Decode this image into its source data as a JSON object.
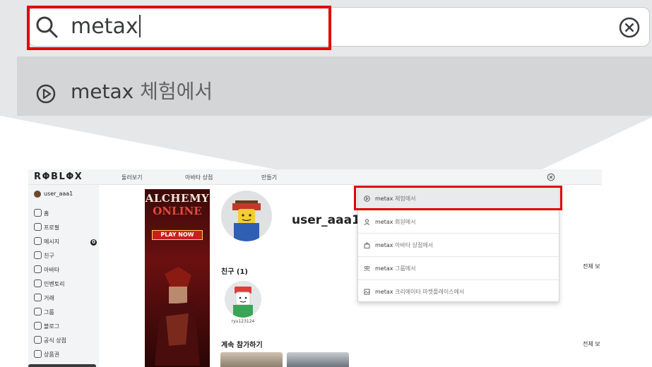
{
  "search": {
    "query": "metax",
    "suggestion": {
      "query": "metax",
      "suffix": "체험에서"
    }
  },
  "mini": {
    "logo": "RΦBLΦX",
    "nav": [
      "둘러보기",
      "아바타 상점",
      "만들기"
    ],
    "sidebar": {
      "user": "user_aaa1",
      "items": [
        {
          "label": "홈",
          "icon": "home-icon"
        },
        {
          "label": "프로필",
          "icon": "profile-icon"
        },
        {
          "label": "메시지",
          "icon": "message-icon",
          "badge": "0"
        },
        {
          "label": "친구",
          "icon": "friends-icon"
        },
        {
          "label": "아바타",
          "icon": "avatar-icon"
        },
        {
          "label": "인벤토리",
          "icon": "inventory-icon"
        },
        {
          "label": "거래",
          "icon": "trade-icon"
        },
        {
          "label": "그룹",
          "icon": "groups-icon"
        },
        {
          "label": "블로그",
          "icon": "blog-icon"
        },
        {
          "label": "공식 상점",
          "icon": "store-icon"
        },
        {
          "label": "상품권",
          "icon": "gift-card-icon"
        }
      ]
    },
    "ad": {
      "line1": "ALCHEMY",
      "line2": "ONLINE",
      "cta": "PLAY NOW"
    },
    "profile": {
      "username": "user_aaa1"
    },
    "friends": {
      "title": "친구 (1)",
      "see_all": "전체 보",
      "friend_name": "ryu123124"
    },
    "continue": {
      "title": "계속 참가하기",
      "see_all": "전체 보"
    },
    "dropdown": [
      {
        "query": "metax",
        "suffix": "체험에서",
        "icon": "play-icon"
      },
      {
        "query": "metax",
        "suffix": "회원에서",
        "icon": "person-icon"
      },
      {
        "query": "metax",
        "suffix": "아바타 상점에서",
        "icon": "shop-icon"
      },
      {
        "query": "metax",
        "suffix": "그룹에서",
        "icon": "groups-icon"
      },
      {
        "query": "metax",
        "suffix": "크리에이터 마켓플레이스에서",
        "icon": "marketplace-icon"
      }
    ]
  },
  "colors": {
    "highlight": "#e20000",
    "sidebar_bg": "#f2f4f5",
    "selected_row": "#e9eaeb"
  }
}
